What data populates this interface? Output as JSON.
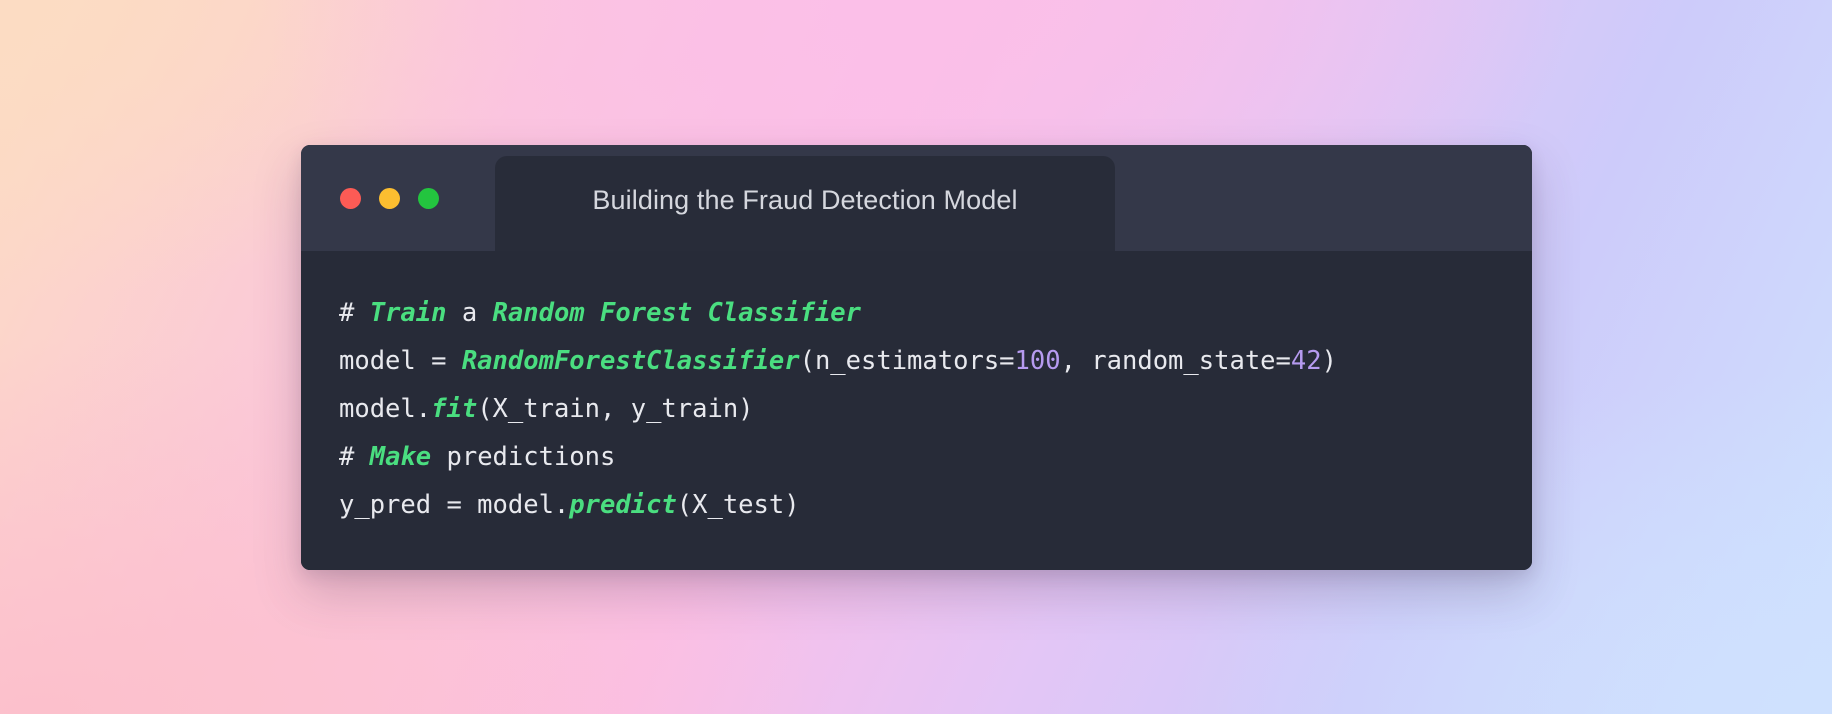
{
  "background": {
    "style": "pastel-mesh-gradient",
    "colors": {
      "top_left": "#fcdcc3",
      "top_mid": "#fbbfe8",
      "top_right": "#cdcbfa",
      "bottom_left": "#fcc0cc",
      "bottom_right": "#cfe1fe"
    }
  },
  "window": {
    "chrome_color": "#343849",
    "body_color": "#272b38",
    "traffic_lights": [
      {
        "name": "close",
        "color": "#fc5b55"
      },
      {
        "name": "minimize",
        "color": "#fcbe30"
      },
      {
        "name": "maximize",
        "color": "#23c53f"
      }
    ],
    "tab": {
      "title": "Building the Fraud Detection Model"
    }
  },
  "code": {
    "language": "python",
    "theme": {
      "plain": "#e8e9ee",
      "keyword": "#4ade80",
      "number": "#b69bf0"
    },
    "plain_text": "# Train a Random Forest Classifier\nmodel = RandomForestClassifier(n_estimators=100, random_state=42)\nmodel.fit(X_train, y_train)\n# Make predictions\ny_pred = model.predict(X_test)",
    "lines": [
      {
        "tokens": [
          {
            "t": "# ",
            "k": "plain"
          },
          {
            "t": "Train",
            "k": "kw"
          },
          {
            "t": " a ",
            "k": "plain"
          },
          {
            "t": "Random Forest Classifier",
            "k": "kw"
          }
        ]
      },
      {
        "tokens": [
          {
            "t": "model = ",
            "k": "plain"
          },
          {
            "t": "RandomForestClassifier",
            "k": "kw"
          },
          {
            "t": "(n_estimators=",
            "k": "plain"
          },
          {
            "t": "100",
            "k": "num"
          },
          {
            "t": ", random_state=",
            "k": "plain"
          },
          {
            "t": "42",
            "k": "num"
          },
          {
            "t": ")",
            "k": "plain"
          }
        ]
      },
      {
        "tokens": [
          {
            "t": "model.",
            "k": "plain"
          },
          {
            "t": "fit",
            "k": "kw"
          },
          {
            "t": "(X_train, y_train)",
            "k": "plain"
          }
        ]
      },
      {
        "tokens": [
          {
            "t": "# ",
            "k": "plain"
          },
          {
            "t": "Make",
            "k": "kw"
          },
          {
            "t": " predictions",
            "k": "plain"
          }
        ]
      },
      {
        "tokens": [
          {
            "t": "y_pred = model.",
            "k": "plain"
          },
          {
            "t": "predict",
            "k": "kw"
          },
          {
            "t": "(X_test)",
            "k": "plain"
          }
        ]
      }
    ]
  }
}
